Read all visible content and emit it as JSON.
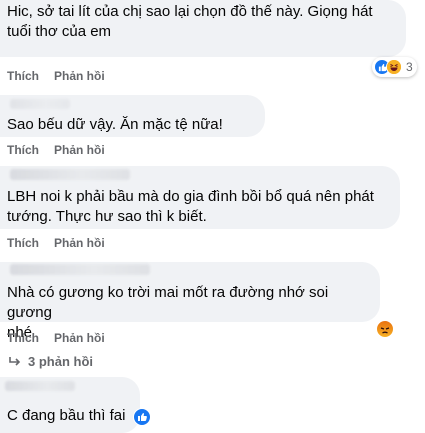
{
  "comments": [
    {
      "text_lines": [
        "Hic, sở tai lít của chị sao lại chọn đồ thế này. Giọng hát",
        "tuổi thơ của em"
      ],
      "like_label": "Thích",
      "reply_label": "Phản hồi",
      "reaction_count": "3",
      "reactions": [
        "like-icon",
        "haha-icon"
      ]
    },
    {
      "text_lines": [
        "Sao bếu dữ vậy. Ăn mặc tệ nữa!"
      ],
      "like_label": "Thích",
      "reply_label": "Phản hồi"
    },
    {
      "text_lines": [
        "LBH noi k phải bầu mà do gia đình bồi bổ quá nên phát",
        "tướng. Thực hư sao thì k biết."
      ],
      "like_label": "Thích",
      "reply_label": "Phản hồi"
    },
    {
      "text_lines": [
        "Nhà có gương ko trời mai mốt ra đường nhớ soi gương",
        "nhé"
      ],
      "like_label": "Thích",
      "reply_label": "Phản hồi",
      "reactions": [
        "angry-icon"
      ],
      "replies_label": "3 phản hồi"
    },
    {
      "text_lines": [
        "C đang bầu thì fai"
      ],
      "reactions": [
        "like-icon"
      ]
    }
  ],
  "colors": {
    "bubble_bg": "#f0f2f5",
    "action_text": "#65676b",
    "like_blue": "#1877f2"
  }
}
